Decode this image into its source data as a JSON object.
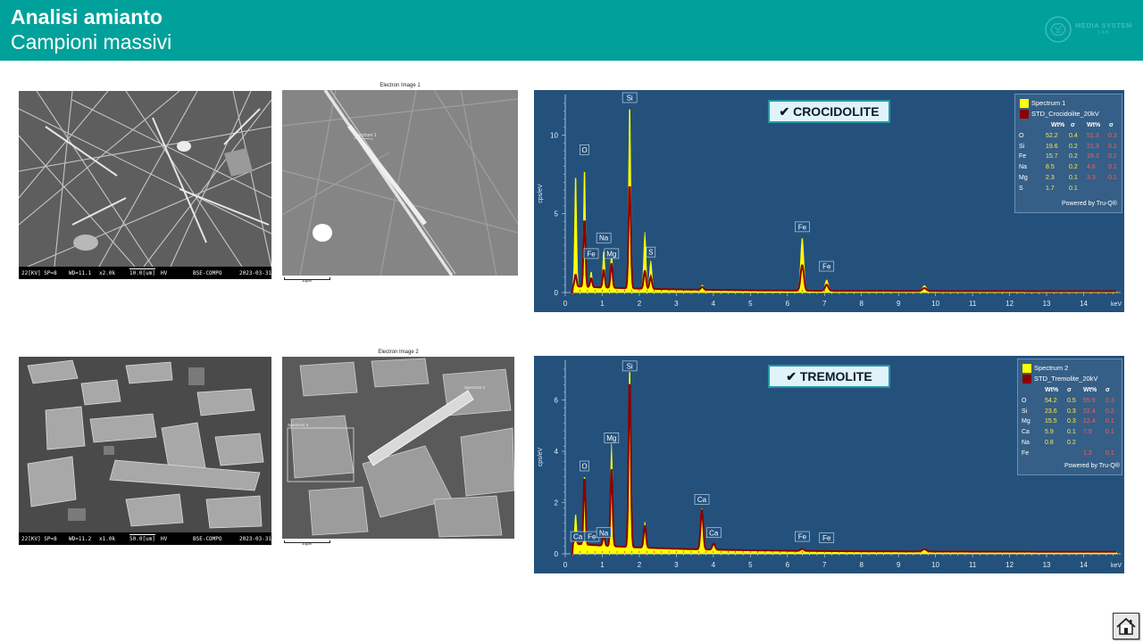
{
  "header": {
    "title": "Analisi amianto",
    "subtitle": "Campioni massivi",
    "logo_text": "MEDIA SYSTEM",
    "logo_sub": "LAB"
  },
  "colors": {
    "header": "#00a19a",
    "spectrum_bg": "#23517c",
    "spectrum1": "#ffff00",
    "spectrum2": "#8b0000"
  },
  "rows": [
    {
      "sem": {
        "footer": [
          "22[KV] SP=8",
          "WD=11.1",
          "x2.0k",
          "10.0[um]",
          "HV",
          "BSE-COMPO",
          "2023-03-31"
        ]
      },
      "electron": {
        "title": "Electron Image 1",
        "spot": "Spectrum 1",
        "scale": "10µm"
      },
      "spectrum": {
        "badge": "✔ CROCIDOLITE",
        "ylabel": "cps/eV",
        "yticks": [
          "0",
          "5",
          "10"
        ],
        "xticks": [
          "0",
          "1",
          "2",
          "3",
          "4",
          "5",
          "6",
          "7",
          "8",
          "9",
          "10",
          "11",
          "12",
          "13",
          "14"
        ],
        "xunit": "keV",
        "legend": {
          "series": [
            "Spectrum 1",
            "STD_Crocidolite_20kV"
          ],
          "headers": [
            "Wt%",
            "σ",
            "Wt%",
            "σ"
          ],
          "rows": [
            [
              "O",
              "52.2",
              "0.4",
              "51.3",
              "0.3"
            ],
            [
              "Si",
              "19.6",
              "0.2",
              "21.3",
              "0.2"
            ],
            [
              "Fe",
              "15.7",
              "0.2",
              "19.3",
              "0.2"
            ],
            [
              "Na",
              "8.5",
              "0.2",
              "4.8",
              "0.1"
            ],
            [
              "Mg",
              "2.3",
              "0.1",
              "3.3",
              "0.1"
            ],
            [
              "S",
              "1.7",
              "0.1",
              "",
              ""
            ]
          ],
          "powered": "Powered by Tru-Q®"
        },
        "peaks": [
          {
            "label": "Si",
            "kev": 1.74
          },
          {
            "label": "O",
            "kev": 0.52
          },
          {
            "label": "Na",
            "kev": 1.04
          },
          {
            "label": "Fe",
            "kev": 0.7
          },
          {
            "label": "Mg",
            "kev": 1.25
          },
          {
            "label": "S",
            "kev": 2.31
          },
          {
            "label": "Fe",
            "kev": 6.4
          },
          {
            "label": "Fe",
            "kev": 7.06
          }
        ]
      }
    },
    {
      "sem": {
        "footer": [
          "22[KV] SP=8",
          "WD=11.2",
          "x1.0k",
          "50.0[um]",
          "HV",
          "BSE-COMPO",
          "2023-03-31"
        ]
      },
      "electron": {
        "title": "Electron Image 2",
        "spot": "Spectrum 2",
        "spot2": "Spectrum 3",
        "scale": "10µm"
      },
      "spectrum": {
        "badge": "✔  TREMOLITE",
        "ylabel": "cps/eV",
        "yticks": [
          "0",
          "2",
          "4",
          "6"
        ],
        "xticks": [
          "0",
          "1",
          "2",
          "3",
          "4",
          "5",
          "6",
          "7",
          "8",
          "9",
          "10",
          "11",
          "12",
          "13",
          "14"
        ],
        "xunit": "keV",
        "legend": {
          "series": [
            "Spectrum 2",
            "STD_Tremolite_20kV"
          ],
          "headers": [
            "Wt%",
            "σ",
            "Wt%",
            "σ"
          ],
          "rows": [
            [
              "O",
              "54.2",
              "0.5",
              "55.9",
              "0.3"
            ],
            [
              "Si",
              "23.6",
              "0.3",
              "22.4",
              "0.2"
            ],
            [
              "Mg",
              "15.5",
              "0.3",
              "12.4",
              "0.1"
            ],
            [
              "Ca",
              "5.9",
              "0.1",
              "7.9",
              "0.1"
            ],
            [
              "Na",
              "0.8",
              "0.2",
              "",
              ""
            ],
            [
              "Fe",
              "",
              "",
              "1.3",
              "0.1"
            ]
          ],
          "powered": "Powered by Tru-Q®"
        },
        "peaks": [
          {
            "label": "Si",
            "kev": 1.74
          },
          {
            "label": "Mg",
            "kev": 1.25
          },
          {
            "label": "O",
            "kev": 0.52
          },
          {
            "label": "Ca",
            "kev": 3.69
          },
          {
            "label": "Ca",
            "kev": 4.01
          },
          {
            "label": "Ca",
            "kev": 0.34
          },
          {
            "label": "Fe",
            "kev": 0.7
          },
          {
            "label": "Na",
            "kev": 1.04
          },
          {
            "label": "Fe",
            "kev": 6.4
          },
          {
            "label": "Fe",
            "kev": 7.06
          }
        ]
      }
    }
  ]
}
